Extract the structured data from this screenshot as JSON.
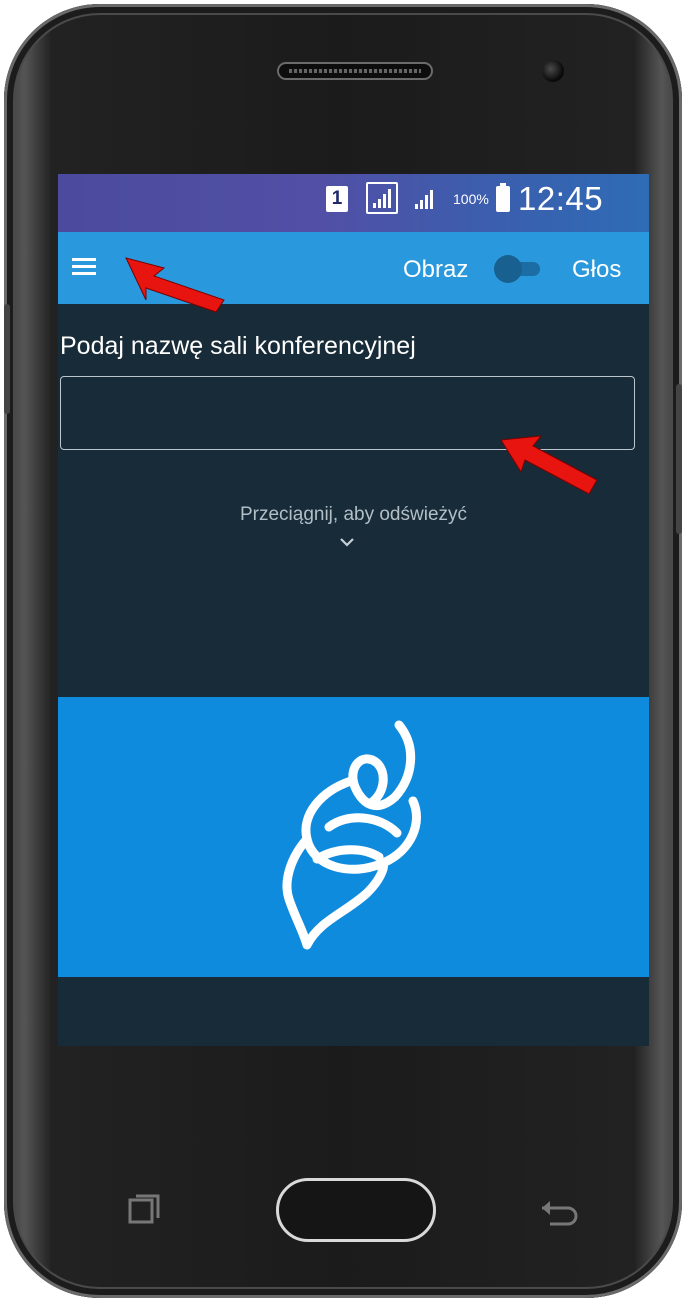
{
  "status_bar": {
    "sim_label": "1",
    "battery_percent": "100%",
    "time": "12:45",
    "background_colors": [
      "#4b4a9e",
      "#2e6cb6"
    ]
  },
  "app_bar": {
    "menu_icon": "hamburger-menu-icon",
    "video_label": "Obraz",
    "audio_label": "Głos",
    "toggle_state": "off",
    "background_color": "#2a98dd"
  },
  "main": {
    "prompt": "Podaj nazwę sali konferencyjnej",
    "room_input_value": "",
    "pull_to_refresh": "Przeciągnij, aby odświeżyć",
    "background_color": "#172b38"
  },
  "banner": {
    "logo_icon": "jitsi-logo-icon",
    "background_color": "#0f8bdd"
  },
  "annotations": {
    "arrow_color": "#e8140f"
  },
  "device": {
    "buttons": [
      "recent-apps-icon",
      "home-button",
      "back-icon"
    ]
  }
}
